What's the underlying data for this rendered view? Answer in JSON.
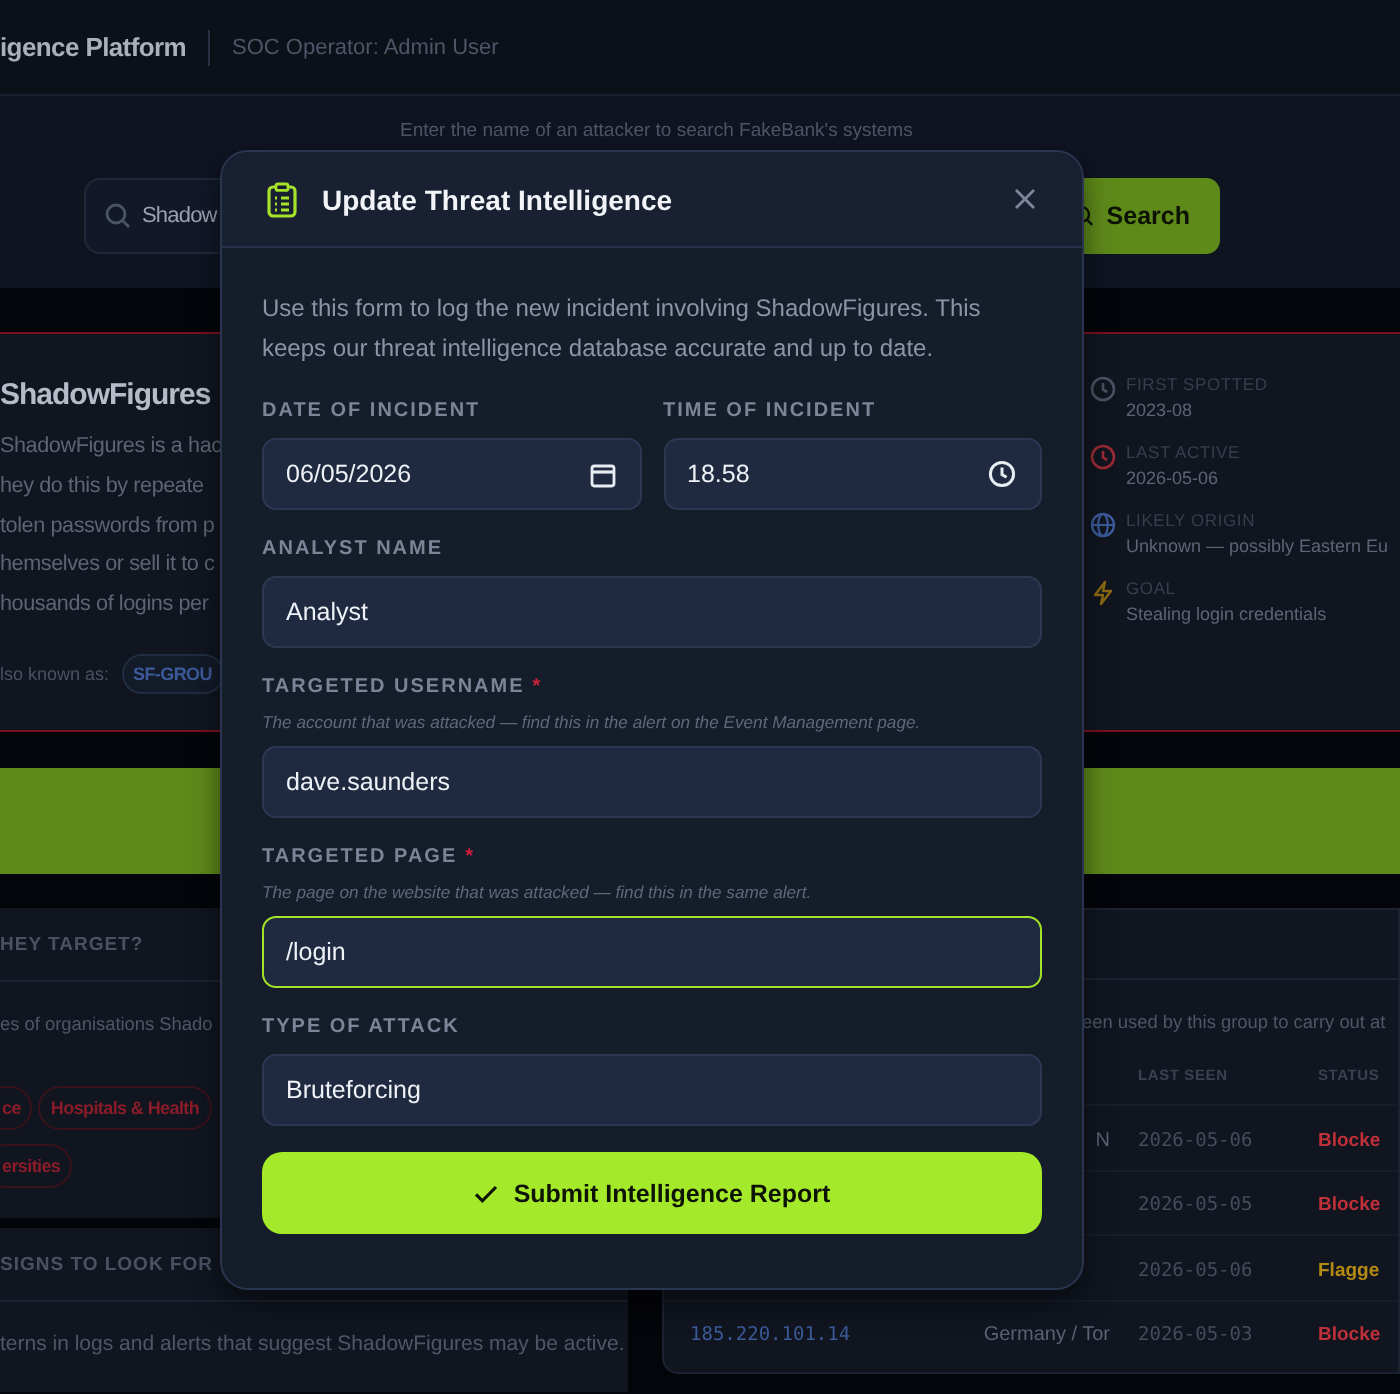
{
  "header": {
    "title": "igence Platform",
    "operator": "SOC Operator: Admin User"
  },
  "search": {
    "hint": "Enter the name of an attacker to search FakeBank's systems",
    "value": "Shadow",
    "button": "Search"
  },
  "profile": {
    "name": "ShadowFigures",
    "description_lines": [
      "ShadowFigures is a hac",
      "hey do this by repeate",
      "tolen passwords from p",
      "hemselves or sell it to c",
      "housands of logins per"
    ],
    "aka_label": "lso known as:",
    "aka_chips": [
      "SF-GROU"
    ],
    "facts": [
      {
        "kind": "first-seen",
        "label": "FIRST SPOTTED",
        "value": "2023-08"
      },
      {
        "kind": "last-active",
        "label": "LAST ACTIVE",
        "value": "2026-05-06"
      },
      {
        "kind": "origin",
        "label": "LIKELY ORIGIN",
        "value": "Unknown — possibly Eastern Eu"
      },
      {
        "kind": "goal",
        "label": "GOAL",
        "value": "Stealing login credentials"
      }
    ]
  },
  "targets": {
    "heading": "HEY TARGET?",
    "text": "es of organisations Shado",
    "tags": [
      "ce",
      "Hospitals & Health",
      "ersities"
    ]
  },
  "signs": {
    "heading": "SIGNS TO LOOK FOR",
    "text": "terns in logs and alerts that suggest ShadowFigures may be active."
  },
  "infrastructure": {
    "text": "een used by this group to carry out at",
    "columns": [
      "LAST SEEN",
      "STATUS"
    ],
    "rows": [
      {
        "origin": "N",
        "last_seen": "2026-05-06",
        "status": "Blocke",
        "color": "#c0303a"
      },
      {
        "last_seen": "2026-05-05",
        "status": "Blocke",
        "color": "#c0303a"
      },
      {
        "last_seen": "2026-05-06",
        "status": "Flagge",
        "color": "#b58a12"
      },
      {
        "ip": "185.220.101.14",
        "origin": "Germany / Tor",
        "last_seen": "2026-05-03",
        "status": "Blocke",
        "color": "#c0303a"
      }
    ]
  },
  "modal": {
    "title": "Update Threat Intelligence",
    "intro": "Use this form to log the new incident involving ShadowFigures. This keeps our threat intelligence database accurate and up to date.",
    "datetime": [
      {
        "kind": "date",
        "label": "DATE OF INCIDENT",
        "value": "06/05/2026"
      },
      {
        "kind": "time",
        "label": "TIME OF INCIDENT",
        "value": "18.58"
      }
    ],
    "fields": [
      {
        "label": "ANALYST NAME",
        "value": "Analyst",
        "focused": false
      },
      {
        "label": "TARGETED USERNAME",
        "required_mark": "*",
        "hint": "The account that was attacked — find this in the alert on the Event Management page.",
        "value": "dave.saunders",
        "focused": false
      },
      {
        "label": "TARGETED PAGE",
        "required_mark": "*",
        "hint": "The page on the website that was attacked — find this in the same alert.",
        "value": "/login",
        "focused": true
      },
      {
        "label": "TYPE OF ATTACK",
        "value": "Bruteforcing",
        "focused": false
      }
    ],
    "submit": "Submit Intelligence Report"
  }
}
